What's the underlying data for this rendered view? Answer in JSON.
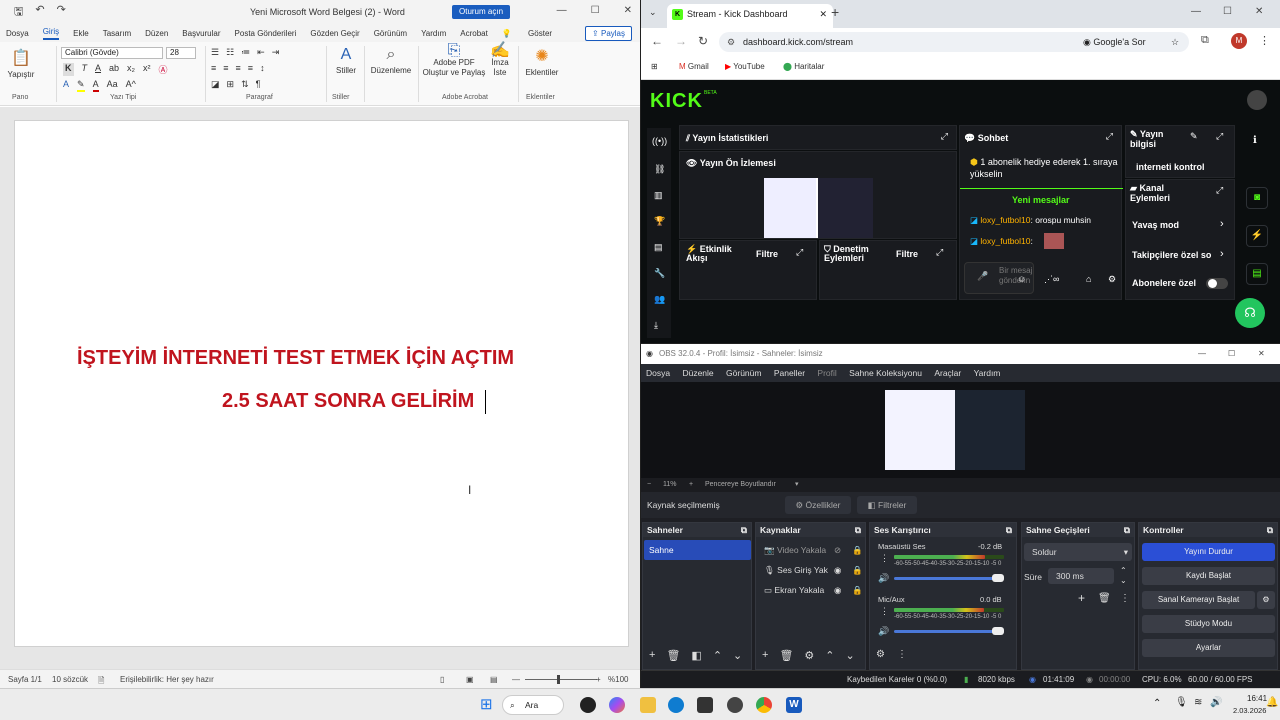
{
  "word": {
    "title": "Yeni Microsoft Word Belgesi (2)  -  Word",
    "signin": "Oturum açın",
    "tabs": [
      "Dosya",
      "Giriş",
      "Ekle",
      "Tasarım",
      "Düzen",
      "Başvurular",
      "Posta Gönderileri",
      "Gözden Geçir",
      "Görünüm",
      "Yardım",
      "Acrobat",
      "Göster"
    ],
    "share": "Paylaş",
    "ribbon": {
      "paste": "Yapıştır",
      "font_name": "Calibri (Gövde)",
      "font_size": "28",
      "styles": "Stiller",
      "editing": "Düzenleme",
      "adobe_pdf": "Adobe PDF Oluştur ve Paylaş",
      "sign": "İmza İste",
      "addins": "Eklentiler",
      "groups": [
        "Pano",
        "Yazı Tipi",
        "Paragraf",
        "Stiller",
        "Adobe Acrobat",
        "Eklentiler"
      ]
    },
    "document": {
      "line1": "İŞTEYİM İNTERNETİ TEST ETMEK İÇİN AÇTIM",
      "line2": "2.5 SAAT SONRA GELİRİM"
    },
    "status": {
      "page": "Sayfa 1/1",
      "words": "10 sözcük",
      "accessibility": "Erişilebilirlik: Her şey hazır",
      "zoom": "%100"
    }
  },
  "chrome": {
    "tab_title": "Stream - Kick Dashboard",
    "url": "dashboard.kick.com/stream",
    "google_lens": "Google'a Sor",
    "profile_initial": "M",
    "bookmarks": [
      "Gmail",
      "YouTube",
      "Haritalar"
    ]
  },
  "kick": {
    "logo": "KICK",
    "logo_beta": "BETA",
    "stats_title": "Yayın İstatistikleri",
    "preview_title": "Yayın Ön İzlemesi",
    "activity_title": "Etkinlik Akışı",
    "activity_filter": "Filtre",
    "mod_title": "Denetim Eylemleri",
    "mod_filter": "Filtre",
    "chat_title": "Sohbet",
    "pinned": "1 abonelik hediye ederek 1. sıraya yükselin",
    "new_messages": "Yeni mesajlar",
    "messages": [
      {
        "user": "loxy_futbol10",
        "text": ": orospu muhsin"
      },
      {
        "user": "loxy_futbol10",
        "text": ":"
      }
    ],
    "chat_placeholder": "Bir mesaj gönderin",
    "info_title": "Yayın bilgisi",
    "info_value": "interneti kontrol",
    "channel_actions_title": "Kanal Eylemleri",
    "actions": [
      "Yavaş mod",
      "Takipçilere özel sohbet",
      "Abonelere özel"
    ]
  },
  "obs": {
    "title": "OBS 32.0.4 - Profil: İsimsiz - Sahneler: İsimsiz",
    "menu": [
      "Dosya",
      "Düzenle",
      "Görünüm",
      "Paneller",
      "Profil",
      "Sahne Koleksiyonu",
      "Araçlar",
      "Yardım"
    ],
    "zoom": "11%",
    "zoom_mode": "Pencereye Boyutlandır",
    "no_source": "Kaynak seçilmemiş",
    "properties": "Özellikler",
    "filters": "Filtreler",
    "docks": {
      "scenes": "Sahneler",
      "sources": "Kaynaklar",
      "mixer": "Ses Karıştırıcı",
      "transitions": "Sahne Geçişleri",
      "controls": "Kontroller"
    },
    "scenes": [
      "Sahne"
    ],
    "sources": [
      "Video Yakala",
      "Ses Giriş Yak",
      "Ekran Yakala"
    ],
    "mixer": [
      {
        "name": "Masaüstü Ses",
        "db": "-0.2 dB",
        "level": 0.83
      },
      {
        "name": "Mic/Aux",
        "db": "0.0 dB",
        "level": 0.82
      }
    ],
    "mixer_scale": "-60-55-50-45-40-35-30-25-20-15-10 -5  0",
    "transition": "Soldur",
    "duration_label": "Süre",
    "duration": "300 ms",
    "controls": [
      "Yayını Durdur",
      "Kaydı Başlat",
      "Sanal Kamerayı Başlat",
      "Stüdyo Modu",
      "Ayarlar"
    ],
    "status": {
      "dropped": "Kaybedilen Kareler 0 (%0.0)",
      "bitrate": "8020 kbps",
      "stream_time": "01:41:09",
      "rec_time": "00:00:00",
      "cpu": "CPU: 6.0%",
      "fps": "60.00 / 60.00 FPS"
    }
  },
  "taskbar": {
    "search": "Ara",
    "time": "16:41",
    "date": "2.03.2026"
  }
}
